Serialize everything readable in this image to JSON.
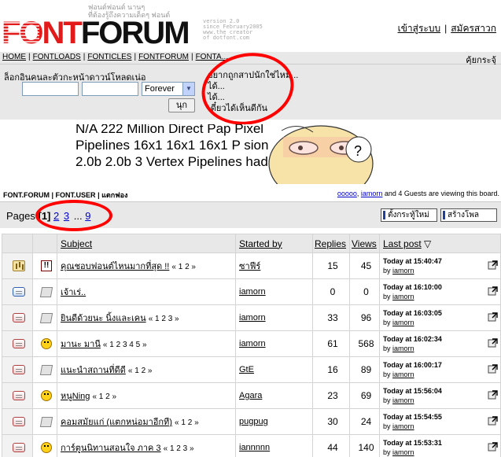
{
  "header": {
    "logo_font": "FONT",
    "logo_forum": "FORUM",
    "tagline_line1": "ฟอนต์ฟอนต์ นานๆ",
    "tagline_line2": "ที่ต้องรู้ถึงความเด็ดๆ ฟอนต์",
    "version_lines": [
      "version 2.0",
      "since February2005",
      "www.the creator",
      "of dotfont.com"
    ],
    "login_link": "เข้าสู่ระบบ",
    "register_link": "สมัครสาวก"
  },
  "navbar": {
    "items": [
      "HOME",
      "FONTLOADS",
      "FONTICLES",
      "FONTFORUM",
      "FONTA..."
    ],
    "right_label": "คุ้ยกระจุ้"
  },
  "login": {
    "title": "ล็อกอินคนละตัวกะหน้าดาวน์โหลดเน่อ",
    "duration": "Forever",
    "submit": "นุก",
    "notes": [
      "อยากถูกสาปนักใช่ไหม...",
      "ได้...",
      "ได้...",
      "เดี๋ยวได้เห็นดีกัน"
    ]
  },
  "banner": {
    "lines": [
      "N/A 222 Million  Direct  Pap        Pixel",
      "Pipelines  16x1 16x1 16x1  P        sion",
      "2.0b 2.0b 3  Vertex Pipelines          hader"
    ],
    "question": "?"
  },
  "strip": {
    "forum": "FONT.FORUM",
    "user": "FONT.USER",
    "extra": "แตกฟอง",
    "viewing_user1": "ooooo",
    "viewing_user2": "iamorn",
    "viewing_rest": "and 4 Guests are viewing this board."
  },
  "pagination": {
    "label": "Pages",
    "current": "[1]",
    "p2": "2",
    "p3": "3",
    "ellipsis": "...",
    "last": "9",
    "notify_button": "ตั้งกระทู้ใหม่",
    "poll_button": "สร้างโพล"
  },
  "table": {
    "headers": {
      "subject": "Subject",
      "started_by": "Started by",
      "replies": "Replies",
      "views": "Views",
      "last_post": "Last post"
    },
    "rows": [
      {
        "title": "คุณชอบฟอนต์ไหนมากที่สุด !!",
        "pages": "« 1 2 »",
        "author": "ซาฟีร์",
        "replies": "15",
        "views": "45",
        "time": "Today at 15:40:47",
        "by": "by",
        "last_user": "iamorn"
      },
      {
        "title": "เจ้าเร่..",
        "pages": "",
        "author": "iamorn",
        "replies": "0",
        "views": "0",
        "time": "Today at 16:10:00",
        "by": "by",
        "last_user": "iamorn"
      },
      {
        "title": "ยินดีด้วยนะ นิ้งและเคน",
        "pages": "« 1 2 3 »",
        "author": "iamorn",
        "replies": "33",
        "views": "96",
        "time": "Today at 16:03:05",
        "by": "by",
        "last_user": "iamorn"
      },
      {
        "title": "มานะ มานี",
        "pages": "« 1 2 3 4 5 »",
        "author": "iamorn",
        "replies": "61",
        "views": "568",
        "time": "Today at 16:02:34",
        "by": "by",
        "last_user": "iamorn"
      },
      {
        "title": "แนะนำสถานที่ดีดี",
        "pages": "« 1 2 »",
        "author": "GtE",
        "replies": "16",
        "views": "89",
        "time": "Today at 16:00:17",
        "by": "by",
        "last_user": "iamorn"
      },
      {
        "title": "หนูNing",
        "pages": "« 1 2 »",
        "author": "Agara",
        "replies": "23",
        "views": "69",
        "time": "Today at 15:56:04",
        "by": "by",
        "last_user": "iamorn"
      },
      {
        "title": "คอมสมัยแก่ (แตกหน่อมาอีกที)",
        "pages": "« 1 2 »",
        "author": "pugpug",
        "replies": "30",
        "views": "24",
        "time": "Today at 15:54:55",
        "by": "by",
        "last_user": "iamorn"
      },
      {
        "title": "การ์ตูนนิทานสอนใจ ภาค 3",
        "pages": "« 1 2 3 »",
        "author": "iannnnn",
        "replies": "44",
        "views": "140",
        "time": "Today at 15:53:31",
        "by": "by",
        "last_user": "iamorn"
      }
    ]
  }
}
